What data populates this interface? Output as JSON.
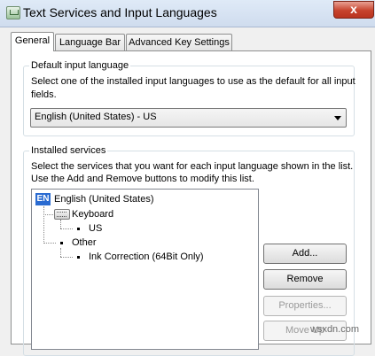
{
  "window": {
    "title": "Text Services and Input Languages",
    "close_glyph": "x"
  },
  "tabs": [
    {
      "label": "General"
    },
    {
      "label": "Language Bar"
    },
    {
      "label": "Advanced Key Settings"
    }
  ],
  "default_input": {
    "legend": "Default input language",
    "description_line1": "Select one of the installed input languages to use as the default for all input",
    "description_line2": "fields.",
    "selected": "English (United States) - US"
  },
  "installed_services": {
    "legend": "Installed services",
    "description_line1": "Select the services that you want for each input language shown in the list.",
    "description_line2": "Use the Add and Remove buttons to modify this list.",
    "tree": {
      "language_badge": "EN",
      "language": "English (United States)",
      "keyboard_label": "Keyboard",
      "keyboard_item": "US",
      "other_label": "Other",
      "other_item": "Ink Correction (64Bit Only)"
    },
    "buttons": {
      "add": "Add...",
      "remove": "Remove",
      "properties": "Properties...",
      "move_up": "Move Up"
    }
  },
  "watermark": "wsxdn.com",
  "colors": {
    "language_badge_bg": "#2a6bd1",
    "close_button": "#c7432d"
  }
}
